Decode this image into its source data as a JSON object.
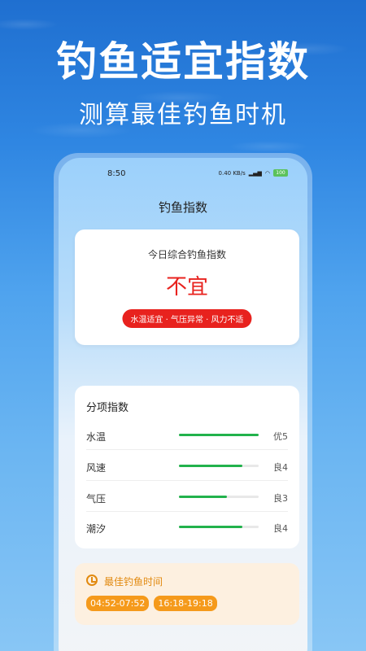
{
  "hero": {
    "title": "钓鱼适宜指数",
    "subtitle": "测算最佳钓鱼时机"
  },
  "status_bar": {
    "time": "8:50",
    "net_speed": "0.40 KB/s",
    "battery": "100"
  },
  "app": {
    "title": "钓鱼指数"
  },
  "overall": {
    "label": "今日综合钓鱼指数",
    "value": "不宜",
    "tags": "水温适宜 · 气压异常 · 风力不适",
    "color": "#e8221e"
  },
  "sub_indexes": {
    "title": "分项指数",
    "items": [
      {
        "name": "水温",
        "score": "优5",
        "level": 1.0
      },
      {
        "name": "风速",
        "score": "良4",
        "level": 0.8
      },
      {
        "name": "气压",
        "score": "良3",
        "level": 0.6
      },
      {
        "name": "潮汐",
        "score": "良4",
        "level": 0.8
      }
    ],
    "bar_color": "#22b24c"
  },
  "best_time": {
    "title": "最佳钓鱼时间",
    "slots": [
      "04:52-07:52",
      "16:18-19:18"
    ],
    "accent": "#f59a1b"
  }
}
